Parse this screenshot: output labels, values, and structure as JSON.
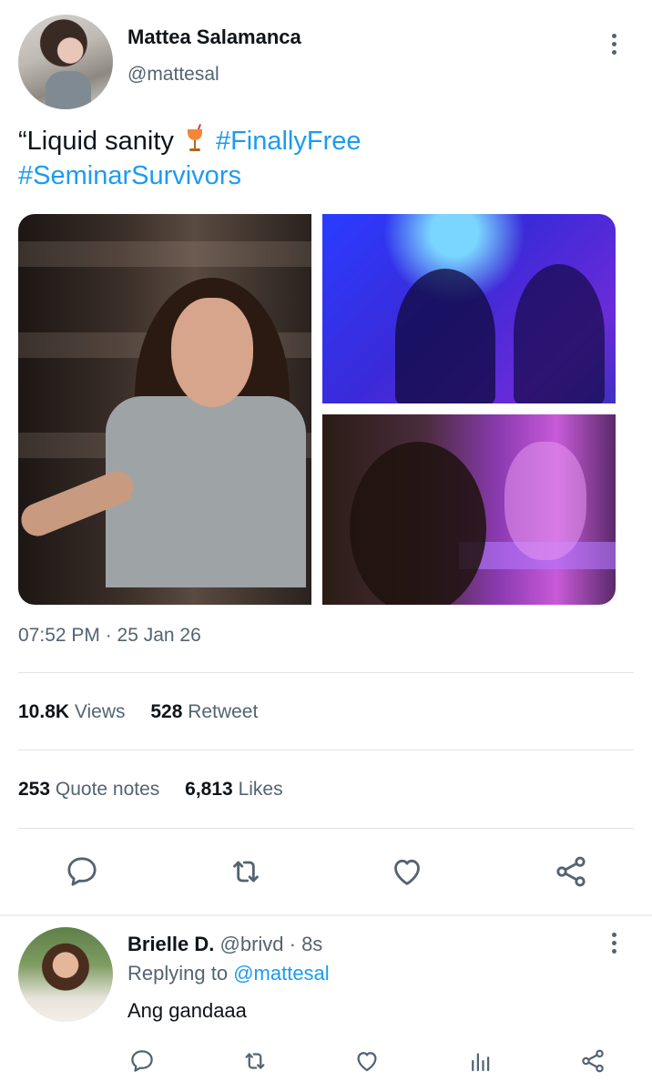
{
  "tweet": {
    "display_name": "Mattea Salamanca",
    "handle": "@mattesal",
    "text_prefix": "“Liquid sanity",
    "emoji": "tropical-drink-emoji",
    "hashtags": [
      "#FinallyFree",
      "#SeminarSurvivors"
    ],
    "timestamp": "07:52 PM · 25 Jan 26",
    "stats": [
      {
        "value": "10.8K",
        "label": "Views"
      },
      {
        "value": "528",
        "label": "Retweet"
      },
      {
        "value": "253",
        "label": "Quote notes"
      },
      {
        "value": "6,813",
        "label": "Likes"
      }
    ],
    "actions": [
      "reply-icon",
      "retweet-icon",
      "like-icon",
      "share-icon"
    ]
  },
  "reply": {
    "display_name": "Brielle D.",
    "handle_time": "@brivd · 8s",
    "replying_label": "Replying to",
    "replying_to": "@mattesal",
    "text": "Ang gandaaa",
    "actions": [
      "reply-icon",
      "retweet-icon",
      "like-icon",
      "analytics-icon",
      "share-icon"
    ]
  },
  "colors": {
    "accent": "#1d9bf0",
    "secondary_text": "#536471",
    "primary_text": "#0f1419"
  }
}
